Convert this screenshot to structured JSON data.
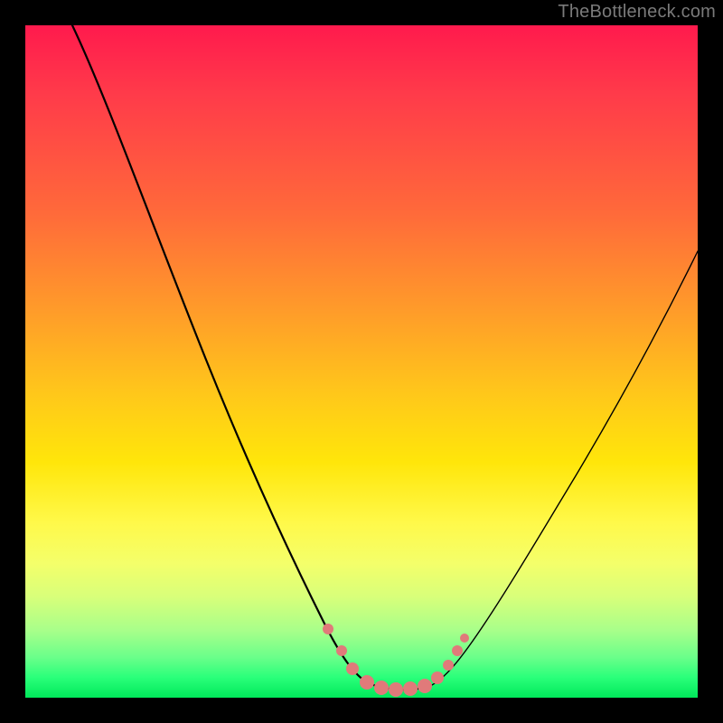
{
  "watermark": "TheBottleneck.com",
  "colors": {
    "frame": "#000000",
    "dot": "#e07a7a",
    "curve": "#000000"
  },
  "chart_data": {
    "type": "line",
    "title": "",
    "xlabel": "",
    "ylabel": "",
    "xlim": [
      0,
      100
    ],
    "ylim": [
      0,
      100
    ],
    "grid": false,
    "legend": false,
    "series": [
      {
        "name": "bottleneck-curve",
        "x": [
          7,
          12,
          18,
          24,
          30,
          36,
          40,
          44,
          46,
          48,
          50,
          52,
          54,
          56,
          58,
          60,
          64,
          70,
          76,
          82,
          88,
          94,
          100
        ],
        "y": [
          100,
          86,
          72,
          58,
          44,
          30,
          20,
          12,
          8,
          5,
          3,
          2,
          2,
          2,
          3,
          5,
          10,
          20,
          32,
          44,
          54,
          62,
          68
        ]
      }
    ],
    "annotations": {
      "dots": [
        {
          "x": 46,
          "y": 8,
          "size": "sm"
        },
        {
          "x": 48,
          "y": 5,
          "size": "sm"
        },
        {
          "x": 50,
          "y": 3,
          "size": "md"
        },
        {
          "x": 52,
          "y": 2,
          "size": "md"
        },
        {
          "x": 54,
          "y": 2,
          "size": "md"
        },
        {
          "x": 56,
          "y": 2,
          "size": "md"
        },
        {
          "x": 58,
          "y": 3,
          "size": "md"
        },
        {
          "x": 60,
          "y": 5,
          "size": "sm"
        },
        {
          "x": 62,
          "y": 8,
          "size": "sm"
        },
        {
          "x": 63.5,
          "y": 10,
          "size": "sm"
        }
      ]
    }
  }
}
